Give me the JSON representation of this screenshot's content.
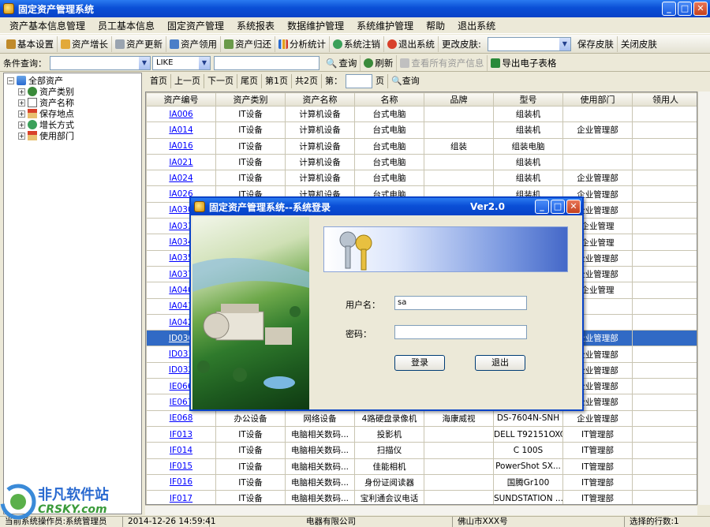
{
  "window": {
    "title": "固定资产管理系统"
  },
  "menu": [
    "资产基本信息管理",
    "员工基本信息",
    "固定资产管理",
    "系统报表",
    "数据维护管理",
    "系统维护管理",
    "帮助",
    "退出系统"
  ],
  "toolbar": {
    "items": [
      "基本设置",
      "资产增长",
      "资产更新",
      "资产领用",
      "资产归还",
      "分析统计",
      "系统注销",
      "退出系统"
    ],
    "skin_label": "更改皮肤:",
    "save_skin": "保存皮肤",
    "close_skin": "关闭皮肤"
  },
  "query": {
    "label": "条件查询：",
    "operator": "LIKE",
    "search": "查询",
    "refresh": "刷新",
    "view_all": "查看所有资产信息",
    "export": "导出电子表格"
  },
  "tree": {
    "root": "全部资产",
    "children": [
      "资产类别",
      "资产名称",
      "保存地点",
      "增长方式",
      "使用部门"
    ]
  },
  "pager": {
    "first": "首页",
    "prev": "上一页",
    "next": "下一页",
    "last": "尾页",
    "current": "第1页",
    "total": "共2页",
    "goto_label": "第：",
    "goto_suffix": "页",
    "search": "查询"
  },
  "table": {
    "columns": [
      "资产编号",
      "资产类别",
      "资产名称",
      "名称",
      "品牌",
      "型号",
      "使用部门",
      "领用人"
    ],
    "rows": [
      [
        "IA006",
        "IT设备",
        "计算机设备",
        "台式电脑",
        "",
        "组装机",
        "",
        ""
      ],
      [
        "IA014",
        "IT设备",
        "计算机设备",
        "台式电脑",
        "",
        "组装机",
        "企业管理部",
        ""
      ],
      [
        "IA016",
        "IT设备",
        "计算机设备",
        "台式电脑",
        "组装",
        "组装电脑",
        "",
        ""
      ],
      [
        "IA021",
        "IT设备",
        "计算机设备",
        "台式电脑",
        "",
        "组装机",
        "",
        ""
      ],
      [
        "IA024",
        "IT设备",
        "计算机设备",
        "台式电脑",
        "",
        "组装机",
        "企业管理部",
        ""
      ],
      [
        "IA026",
        "IT设备",
        "计算机设备",
        "台式电脑",
        "",
        "组装机",
        "企业管理部",
        ""
      ],
      [
        "IA030",
        "",
        "",
        "",
        "",
        "",
        "企业管理部",
        ""
      ],
      [
        "IA033",
        "",
        "",
        "",
        "",
        "",
        "企业管理",
        ""
      ],
      [
        "IA034",
        "",
        "",
        "",
        "",
        "",
        "企业管理",
        ""
      ],
      [
        "IA035",
        "",
        "",
        "",
        "",
        "",
        "企业管理部",
        ""
      ],
      [
        "IA037",
        "",
        "",
        "",
        "",
        "",
        "企业管理部",
        ""
      ],
      [
        "IA040",
        "",
        "",
        "",
        "",
        "",
        "企业管理",
        ""
      ],
      [
        "IA041",
        "",
        "",
        "",
        "",
        "",
        "",
        ""
      ],
      [
        "IA042",
        "",
        "",
        "",
        "",
        "",
        "",
        ""
      ],
      [
        "ID030",
        "",
        "",
        "",
        "",
        "",
        "企业管理部",
        ""
      ],
      [
        "ID031",
        "",
        "",
        "",
        "",
        "",
        "企业管理部",
        ""
      ],
      [
        "ID032",
        "",
        "",
        "",
        "",
        "",
        "企业管理部",
        ""
      ],
      [
        "IE066",
        "",
        "",
        "",
        "",
        "",
        "企业管理部",
        ""
      ],
      [
        "IE067",
        "",
        "",
        "",
        "",
        "",
        "企业管理部",
        ""
      ],
      [
        "IE068",
        "办公设备",
        "网络设备",
        "4路硬盘录像机",
        "海康威视",
        "DS-7604N-SNH",
        "企业管理部",
        ""
      ],
      [
        "IF013",
        "IT设备",
        "电脑相关数码...",
        "投影机",
        "",
        "DELL T92151OXCN",
        "IT管理部",
        ""
      ],
      [
        "IF014",
        "IT设备",
        "电脑相关数码...",
        "扫描仪",
        "",
        "C 100S",
        "IT管理部",
        ""
      ],
      [
        "IF015",
        "IT设备",
        "电脑相关数码...",
        "佳能相机",
        "",
        "PowerShot SX...",
        "IT管理部",
        ""
      ],
      [
        "IF016",
        "IT设备",
        "电脑相关数码...",
        "身份证阅读器",
        "",
        "国腾Gr100",
        "IT管理部",
        ""
      ],
      [
        "IF017",
        "IT设备",
        "电脑相关数码...",
        "宝利通会议电话",
        "",
        "SUNDSTATION ...",
        "IT管理部",
        ""
      ]
    ],
    "selected_index": 14
  },
  "login": {
    "title": "固定资产管理系统--系统登录",
    "version": "Ver2.0",
    "user_label": "用户名：",
    "user_value": "sa",
    "password_label": "密码：",
    "password_value": "",
    "login_button": "登录",
    "exit_button": "退出"
  },
  "status": {
    "left": "当前系统操作员:系统管理员",
    "datetime": "2014-12-26 14:59:41",
    "company": "电器有限公司",
    "address": "佛山市XXX号",
    "selected_rows": "选择的行数:1"
  },
  "watermark": {
    "cn": "非凡软件站",
    "en": "CRSKY.com"
  },
  "colors": {
    "title_blue": "#0a4fd6",
    "selection": "#316ac5",
    "link": "#0000ff"
  }
}
